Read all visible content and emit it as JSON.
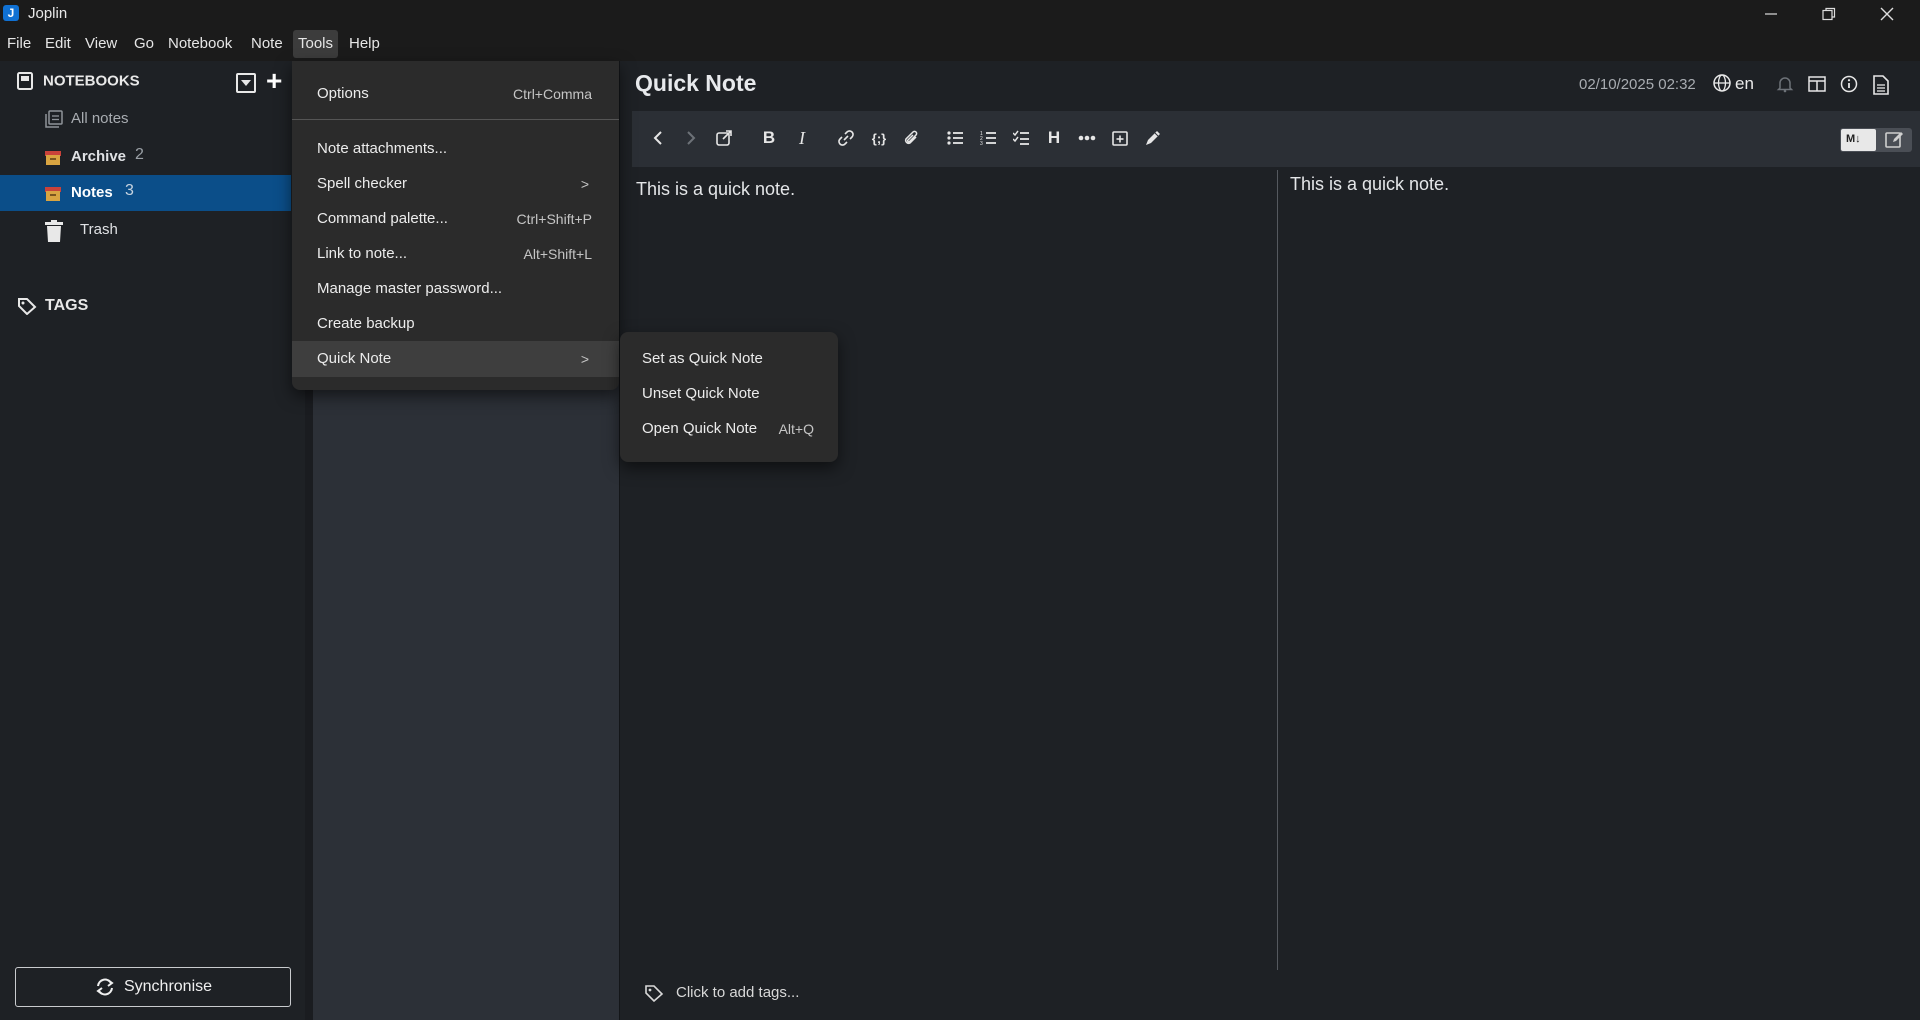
{
  "window": {
    "title": "Joplin",
    "icon_letter": "J"
  },
  "menubar": [
    "File",
    "Edit",
    "View",
    "Go",
    "Notebook",
    "Note",
    "Tools",
    "Help"
  ],
  "sidebar": {
    "notebooks_title": "NOTEBOOKS",
    "items": [
      {
        "label": "All notes",
        "count": ""
      },
      {
        "label": "Archive",
        "count": "2"
      },
      {
        "label": "Notes",
        "count": "3"
      },
      {
        "label": "Trash",
        "count": ""
      }
    ],
    "tags_title": "TAGS",
    "sync_label": "Synchronise"
  },
  "editor": {
    "title": "Quick Note",
    "date": "02/10/2025 02:32",
    "language": "en",
    "body": "This is a quick note.",
    "viewer_body": "This is a quick note.",
    "tags_placeholder": "Click to add tags...",
    "markdown_toggle": "M↓"
  },
  "tools_menu": [
    {
      "label": "Options",
      "shortcut": "Ctrl+Comma"
    },
    {
      "label": "Note attachments...",
      "shortcut": ""
    },
    {
      "label": "Spell checker",
      "shortcut": ""
    },
    {
      "label": "Command palette...",
      "shortcut": "Ctrl+Shift+P"
    },
    {
      "label": "Link to note...",
      "shortcut": "Alt+Shift+L"
    },
    {
      "label": "Manage master password...",
      "shortcut": ""
    },
    {
      "label": "Create backup",
      "shortcut": ""
    },
    {
      "label": "Quick Note",
      "shortcut": ""
    }
  ],
  "quick_note_submenu": [
    {
      "label": "Set as Quick Note",
      "shortcut": ""
    },
    {
      "label": "Unset Quick Note",
      "shortcut": ""
    },
    {
      "label": "Open Quick Note",
      "shortcut": "Alt+Q"
    }
  ],
  "colors": {
    "accent": "#0b4e89",
    "background": "#1e2125",
    "notelist": "#2c3037",
    "menu": "#2b2b2b"
  }
}
